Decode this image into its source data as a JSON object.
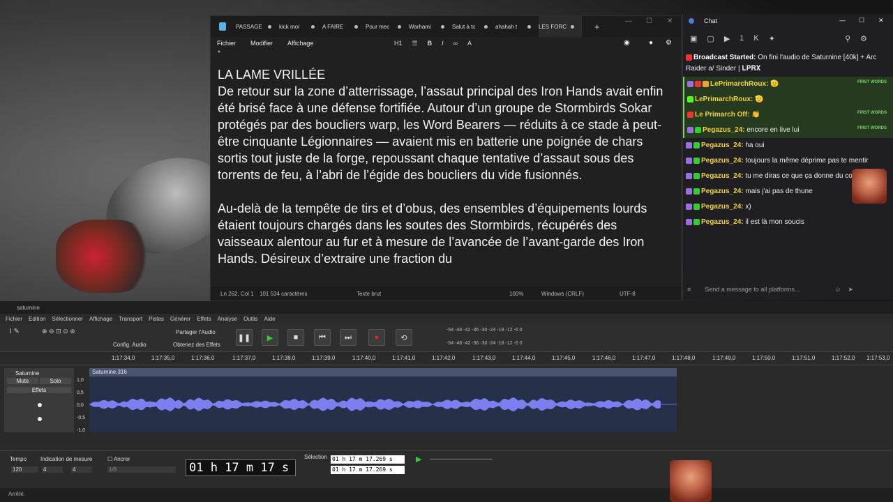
{
  "notepad": {
    "tabs": [
      "PASSAGE",
      "kick moi",
      "A FAIRE",
      "Pour mec",
      "Warhami",
      "Salut à tc",
      "ahahah t",
      "LES FORC"
    ],
    "menu": [
      "Fichier",
      "Modifier",
      "Affichage"
    ],
    "heading_style": "H1",
    "title": "LA LAME VRILLÉE",
    "paragraph1": "De retour sur la zone d’atterrissage, l’assaut principal des Iron Hands avait enfin été brisé face à une défense fortifiée. Autour d’un groupe de Stormbirds Sokar protégés par des boucliers warp, les Word Bearers — réduits à ce stade à peut-être cinquante Légionnaires — avaient mis en batterie une poignée de chars sortis tout juste de la forge, repoussant chaque tentative d’assaut sous des torrents de feu, à l’abri de l’égide des boucliers du vide fusionnés.",
    "paragraph2": "Au-delà de la tempête de tirs et d’obus, des ensembles d’équipements lourds étaient toujours chargés dans les soutes des Stormbirds, récupérés des vaisseaux alentour au fur et à mesure de l’avancée de l’avant-garde des Iron Hands. Désireux d’extraire une fraction du",
    "status": {
      "position": "Ln 262, Col 1",
      "chars": "101 534 caractères",
      "format": "Texte brut",
      "zoom": "100%",
      "eol": "Windows (CRLF)",
      "encoding": "UTF-8"
    }
  },
  "chat": {
    "title": "Chat",
    "count": "1",
    "input_placeholder": "Send a message to all platforms...",
    "first_words": "FIRST WORDS",
    "messages": [
      {
        "user": "Broadcast Started:",
        "text": " On fini l'audio de Saturnine [40k] + Arc Raider a/ Sinder | 𝐋𝐏𝐑𝐗",
        "hl": false
      },
      {
        "user": "LePrimarchRoux:",
        "text": " 🫡",
        "hl": true
      },
      {
        "user": "LePrimarchRoux:",
        "text": " 🫡",
        "hl": true
      },
      {
        "user": "Le Primarch Off:",
        "text": " 👏",
        "hl": true
      },
      {
        "user": "Pegazus_24:",
        "text": " encore en live lui",
        "hl": true
      },
      {
        "user": "Pegazus_24:",
        "text": " ha oui",
        "hl": false
      },
      {
        "user": "Pegazus_24:",
        "text": " toujours la même déprime pas te mentir",
        "hl": false
      },
      {
        "user": "Pegazus_24:",
        "text": " tu me diras ce que ça donne du coup sur Kick",
        "hl": false
      },
      {
        "user": "Pegazus_24:",
        "text": " mais j'ai pas de thune",
        "hl": false
      },
      {
        "user": "Pegazus_24:",
        "text": " x)",
        "hl": false
      },
      {
        "user": "Pegazus_24:",
        "text": " il est là mon soucis",
        "hl": false
      }
    ]
  },
  "audacity": {
    "window_title": "saturnine",
    "menu": [
      "Fichier",
      "Edition",
      "Sélectionner",
      "Affichage",
      "Transport",
      "Pistes",
      "Générer",
      "Effets",
      "Analyse",
      "Outils",
      "Aide"
    ],
    "config_audio": "Config. Audio",
    "share_audio": "Partager l'Audio",
    "get_effects": "Obtenez des Effets",
    "meter_ticks": "-54 -48 -42 -36 -30 -24 -18 -12 -6 0",
    "ruler": [
      "1:17:34,0",
      "1:17:35,0",
      "1:17:36,0",
      "1:17:37,0",
      "1:17:38,0",
      "1:17:39,0",
      "1:17:40,0",
      "1:17:41,0",
      "1:17:42,0",
      "1:17:43,0",
      "1:17:44,0",
      "1:17:45,0",
      "1:17:46,0",
      "1:17:47,0",
      "1:17:48,0",
      "1:17:49,0",
      "1:17:50,0",
      "1:17:51,0",
      "1:17:52,0",
      "1:17:53,0"
    ],
    "track_name": "Saturnine",
    "mute": "Mute",
    "solo": "Solo",
    "effects": "Effets",
    "clip_name": "Saturnine.316",
    "scale": [
      "1,0",
      "0,5",
      "0,0",
      "-0,5",
      "-1,0"
    ],
    "tempo_label": "Tempo",
    "tempo_value": "120",
    "measure_label": "Indication de mesure",
    "measure_num": "4",
    "measure_den": "4",
    "anchor_label": "Ancrer",
    "anchor_value": "1/8",
    "time": "01 h 17 m 17 s",
    "selection_label": "Sélection",
    "sel_start": "01 h 17 m 17.269 s",
    "sel_end": "01 h 17 m 17.269 s",
    "status": "Arrêté."
  }
}
